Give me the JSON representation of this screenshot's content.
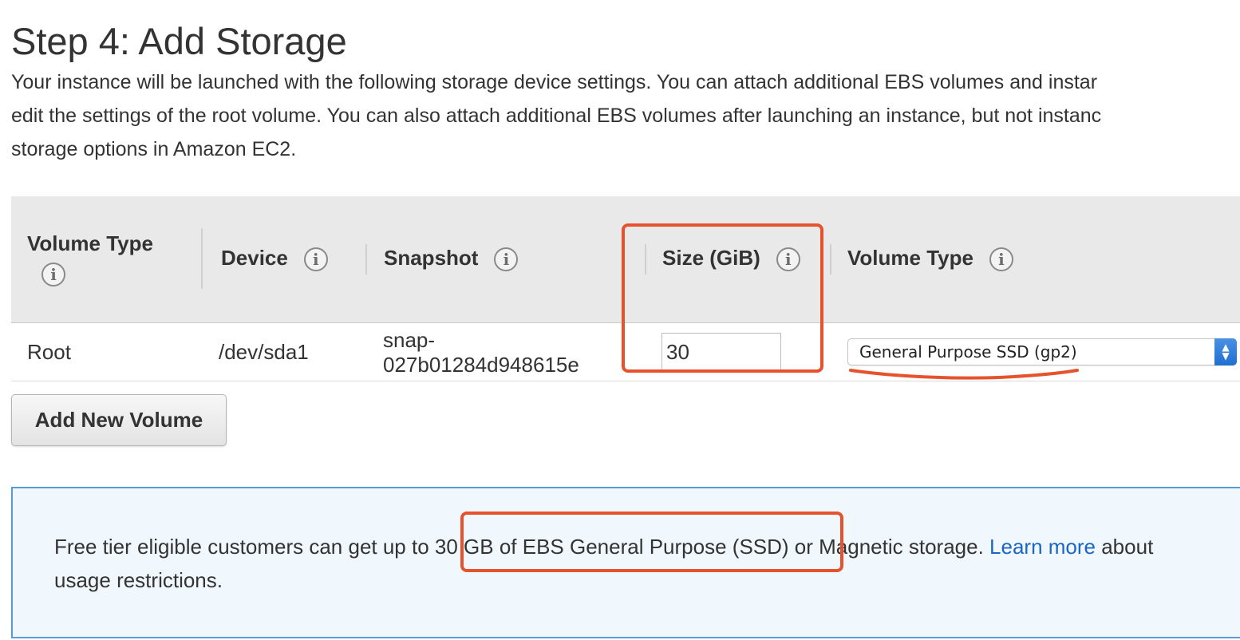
{
  "page": {
    "title": "Step 4: Add Storage",
    "intro_lines": [
      "Your instance will be launched with the following storage device settings. You can attach additional EBS volumes and instar",
      "edit the settings of the root volume. You can also attach additional EBS volumes after launching an instance, but not instanc",
      "storage options in Amazon EC2."
    ]
  },
  "table": {
    "headers": {
      "volume_type_1": "Volume Type",
      "device": "Device",
      "snapshot": "Snapshot",
      "size": "Size (GiB)",
      "volume_type_2": "Volume Type"
    },
    "info_icon_glyph": "i",
    "row": {
      "volume_type": "Root",
      "device": "/dev/sda1",
      "snapshot_line1": "snap-",
      "snapshot_line2": "027b01284d948615e",
      "size_value": "30",
      "volume_type_selected": "General Purpose SSD (gp2)"
    }
  },
  "buttons": {
    "add_new_volume": "Add New Volume"
  },
  "notice": {
    "part1": "Free tier eligible customers can get up to ",
    "highlight": "30 GB of EBS General Purpose (SSD)",
    "part2": " or Magnetic storage. ",
    "link": "Learn more",
    "part3": " about",
    "line2": "usage restrictions."
  },
  "colors": {
    "annotation_red": "#e6522c",
    "link_blue": "#1a66c2",
    "notice_bg": "#f1f8fd",
    "notice_border": "#5a9bd5",
    "header_bg": "#e9e9e9"
  }
}
